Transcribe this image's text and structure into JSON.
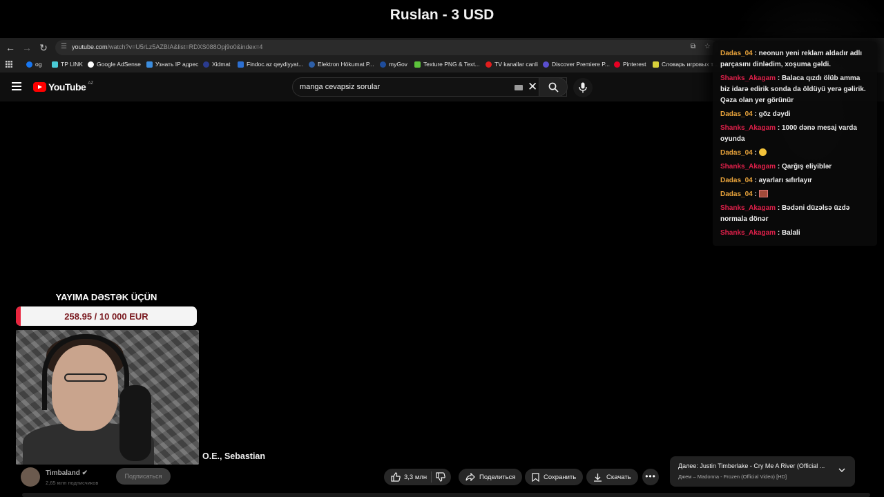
{
  "banner": {
    "title": "Ruslan - 3 USD"
  },
  "browser": {
    "url_main": "youtube.com",
    "url_rest": "/watch?v=U5rLz5AZBIA&list=RDXS088Opj9o0&index=4",
    "bookmarks": [
      {
        "label": "og",
        "color": "#1877f2"
      },
      {
        "label": "TP LINK",
        "color": "#4acbd6"
      },
      {
        "label": "Google AdSense",
        "color": "#fbbc04"
      },
      {
        "label": "Узнать IP адрес",
        "color": "#3c8dde"
      },
      {
        "label": "Xidmat",
        "color": "#2a3b8f"
      },
      {
        "label": "Findoc.az qeydiyyat...",
        "color": "#2c6fd1"
      },
      {
        "label": "Elektron Hökumat P...",
        "color": "#2d5fa8"
      },
      {
        "label": "myGov",
        "color": "#1f4d9c"
      },
      {
        "label": "Texture PNG & Text...",
        "color": "#5cc33b"
      },
      {
        "label": "TV kanallar canli",
        "color": "#e21d1d"
      },
      {
        "label": "Discover Premiere P...",
        "color": "#5a4fcf"
      },
      {
        "label": "Pinterest",
        "color": "#e60023"
      },
      {
        "label": "Словарь игровых т...",
        "color": "#d8d03a"
      }
    ]
  },
  "youtube": {
    "logo_text": "YouTube",
    "logo_region": "AZ",
    "search_query": "manga cevapsiz sorular"
  },
  "chat": {
    "messages": [
      {
        "user": "Dadas_04",
        "type": "d",
        "text": "neonun yeni reklam aldadır adlı parçasını dinlədim, xoşuma gəldi."
      },
      {
        "user": "Shanks_Akagam",
        "type": "s",
        "text": "Balaca qızdı ölüb amma biz idarə edirik sonda da öldüyü yerə gəlirik. Qəza olan yer görünür"
      },
      {
        "user": "Dadas_04",
        "type": "d",
        "text": "göz dəydi"
      },
      {
        "user": "Shanks_Akagam",
        "type": "s",
        "text": "1000 dənə mesaj varda oyunda"
      },
      {
        "user": "Dadas_04",
        "type": "d",
        "text": "",
        "emoji": true
      },
      {
        "user": "Shanks_Akagam",
        "type": "s",
        "text": "Qarğış eliyiblər"
      },
      {
        "user": "Dadas_04",
        "type": "d",
        "text": "ayarları sıfırlayır"
      },
      {
        "user": "Dadas_04",
        "type": "d",
        "text": "",
        "pic": true
      },
      {
        "user": "Shanks_Akagam",
        "type": "s",
        "text": "Bədəni düzəlsə üzdə normala dönər"
      },
      {
        "user": "Shanks_Akagam",
        "type": "s",
        "text": "Balali"
      }
    ]
  },
  "donation": {
    "title": "YAYIMA DƏSTƏK ÜÇÜN",
    "amount_text": "258.95 / 10 000 EUR",
    "progress": 0.026
  },
  "video": {
    "title_partial": "O.E., Sebastian",
    "channel_name": "Timbaland",
    "channel_subs": "2,65 млн подписчиков",
    "subscribe_label": "Подписаться",
    "likes": "3,3 млн",
    "share_label": "Поделиться",
    "save_label": "Сохранить",
    "download_label": "Скачать"
  },
  "up_next": {
    "line1": "Далее: Justin Timberlake - Cry Me A River (Official ...",
    "line2": "Джем – Madonna - Frozen (Official Video) [HD]"
  }
}
